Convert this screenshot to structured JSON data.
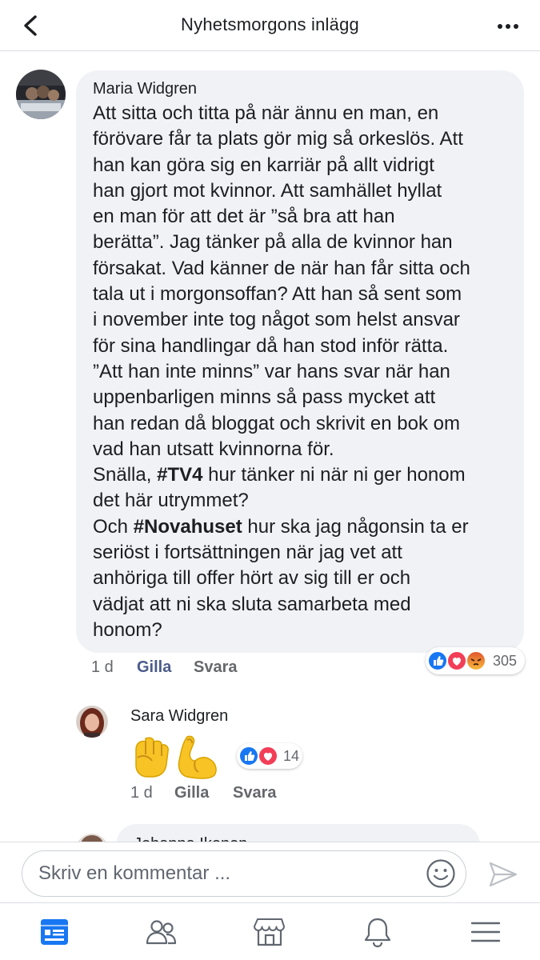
{
  "header": {
    "title": "Nyhetsmorgons inlägg"
  },
  "comments": [
    {
      "author": "Maria Widgren",
      "lines": [
        "Att sitta och titta på när ännu en man, en",
        "förövare får ta plats gör mig så orkeslös. Att",
        "han kan göra sig en karriär på allt vidrigt",
        "han gjort mot kvinnor. Att samhället hyllat",
        "en man för att det är ”så bra att han",
        "berätta”. Jag tänker på alla de kvinnor han",
        "försakat. Vad känner de när han får sitta och",
        "tala ut i morgonsoffan? Att han så sent som",
        "i november inte tog något som helst ansvar",
        "för sina handlingar då han stod inför rätta.",
        "”Att han inte minns” var hans svar när han",
        "uppenbarligen minns så pass mycket att",
        "han redan då bloggat och skrivit en bok om",
        "vad han utsatt kvinnorna för."
      ],
      "line_tv4_pre": "Snälla, ",
      "hashtag_tv4": "#TV4",
      "line_tv4_post": " hur tänker ni när ni ger honom",
      "line_after_tv4": "det här utrymmet?",
      "line_nova_pre": "Och ",
      "hashtag_nova": "#Novahuset",
      "line_nova_post": " hur ska jag någonsin ta er",
      "lines_end": [
        "seriöst i fortsättningen när jag vet att",
        "anhöriga till offer hört av sig till er och",
        "vädjat att ni ska sluta samarbeta med",
        "honom?"
      ],
      "time": "1 d",
      "like_label": "Gilla",
      "reply_label": "Svara",
      "reaction_count": "305",
      "reactions": [
        "like-icon",
        "love-icon",
        "angry-icon"
      ]
    },
    {
      "author": "Sara Widgren",
      "emojis": [
        "raised-fist-icon",
        "flexed-biceps-icon"
      ],
      "time": "1 d",
      "like_label": "Gilla",
      "reply_label": "Svara",
      "reaction_count": "14",
      "reactions": [
        "like-icon",
        "love-icon"
      ]
    },
    {
      "author": "Johanna Ikonen"
    }
  ],
  "composer": {
    "placeholder": "Skriv en kommentar ..."
  },
  "tabs": [
    {
      "icon": "news-feed-icon",
      "active": true
    },
    {
      "icon": "friends-icon",
      "active": false
    },
    {
      "icon": "marketplace-icon",
      "active": false
    },
    {
      "icon": "notifications-bell-icon",
      "active": false
    },
    {
      "icon": "menu-icon",
      "active": false
    }
  ],
  "colors": {
    "brand_blue": "#1877f2",
    "bubble_bg": "#f0f2f5",
    "secondary_text": "#65676b",
    "like_active": "#4b5b8c"
  }
}
